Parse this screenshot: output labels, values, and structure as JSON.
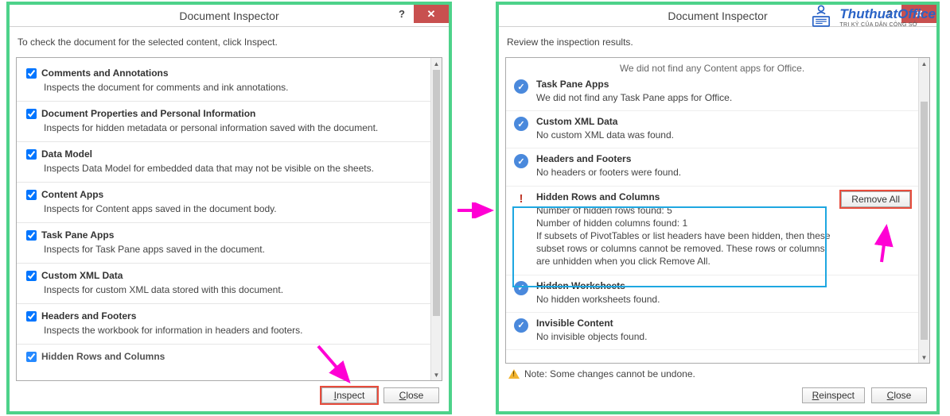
{
  "left": {
    "title": "Document Inspector",
    "instruction": "To check the document for the selected content, click Inspect.",
    "items": [
      {
        "label": "Comments and Annotations",
        "desc": "Inspects the document for comments and ink annotations."
      },
      {
        "label": "Document Properties and Personal Information",
        "desc": "Inspects for hidden metadata or personal information saved with the document."
      },
      {
        "label": "Data Model",
        "desc": "Inspects Data Model for embedded data that may not be visible on the sheets."
      },
      {
        "label": "Content Apps",
        "desc": "Inspects for Content apps saved in the document body."
      },
      {
        "label": "Task Pane Apps",
        "desc": "Inspects for Task Pane apps saved in the document."
      },
      {
        "label": "Custom XML Data",
        "desc": "Inspects for custom XML data stored with this document."
      },
      {
        "label": "Headers and Footers",
        "desc": "Inspects the workbook for information in headers and footers."
      },
      {
        "label": "Hidden Rows and Columns",
        "desc": ""
      }
    ],
    "inspect": "Inspect",
    "close": "Close"
  },
  "right": {
    "title": "Document Inspector",
    "instruction": "Review the inspection results.",
    "clipped": "We did not find any Content apps for Office.",
    "results": [
      {
        "title": "Task Pane Apps",
        "desc": "We did not find any Task Pane apps for Office.",
        "status": "ok"
      },
      {
        "title": "Custom XML Data",
        "desc": "No custom XML data was found.",
        "status": "ok"
      },
      {
        "title": "Headers and Footers",
        "desc": "No headers or footers were found.",
        "status": "ok"
      },
      {
        "title": "Hidden Rows and Columns",
        "desc": "Number of hidden rows found: 5\nNumber of hidden columns found: 1\nIf subsets of PivotTables or list headers have been hidden, then these subset rows or columns cannot be removed. These rows or columns are unhidden when you click Remove All.",
        "status": "warn",
        "action": "Remove All"
      },
      {
        "title": "Hidden Worksheets",
        "desc": "No hidden worksheets found.",
        "status": "ok"
      },
      {
        "title": "Invisible Content",
        "desc": "No invisible objects found.",
        "status": "ok"
      }
    ],
    "note": "Note: Some changes cannot be undone.",
    "reinspect": "Reinspect",
    "close": "Close"
  },
  "watermark": {
    "brand": "ThuthuatOffice",
    "sub": "TRI KỶ CỦA DÂN CÔNG SỞ"
  }
}
